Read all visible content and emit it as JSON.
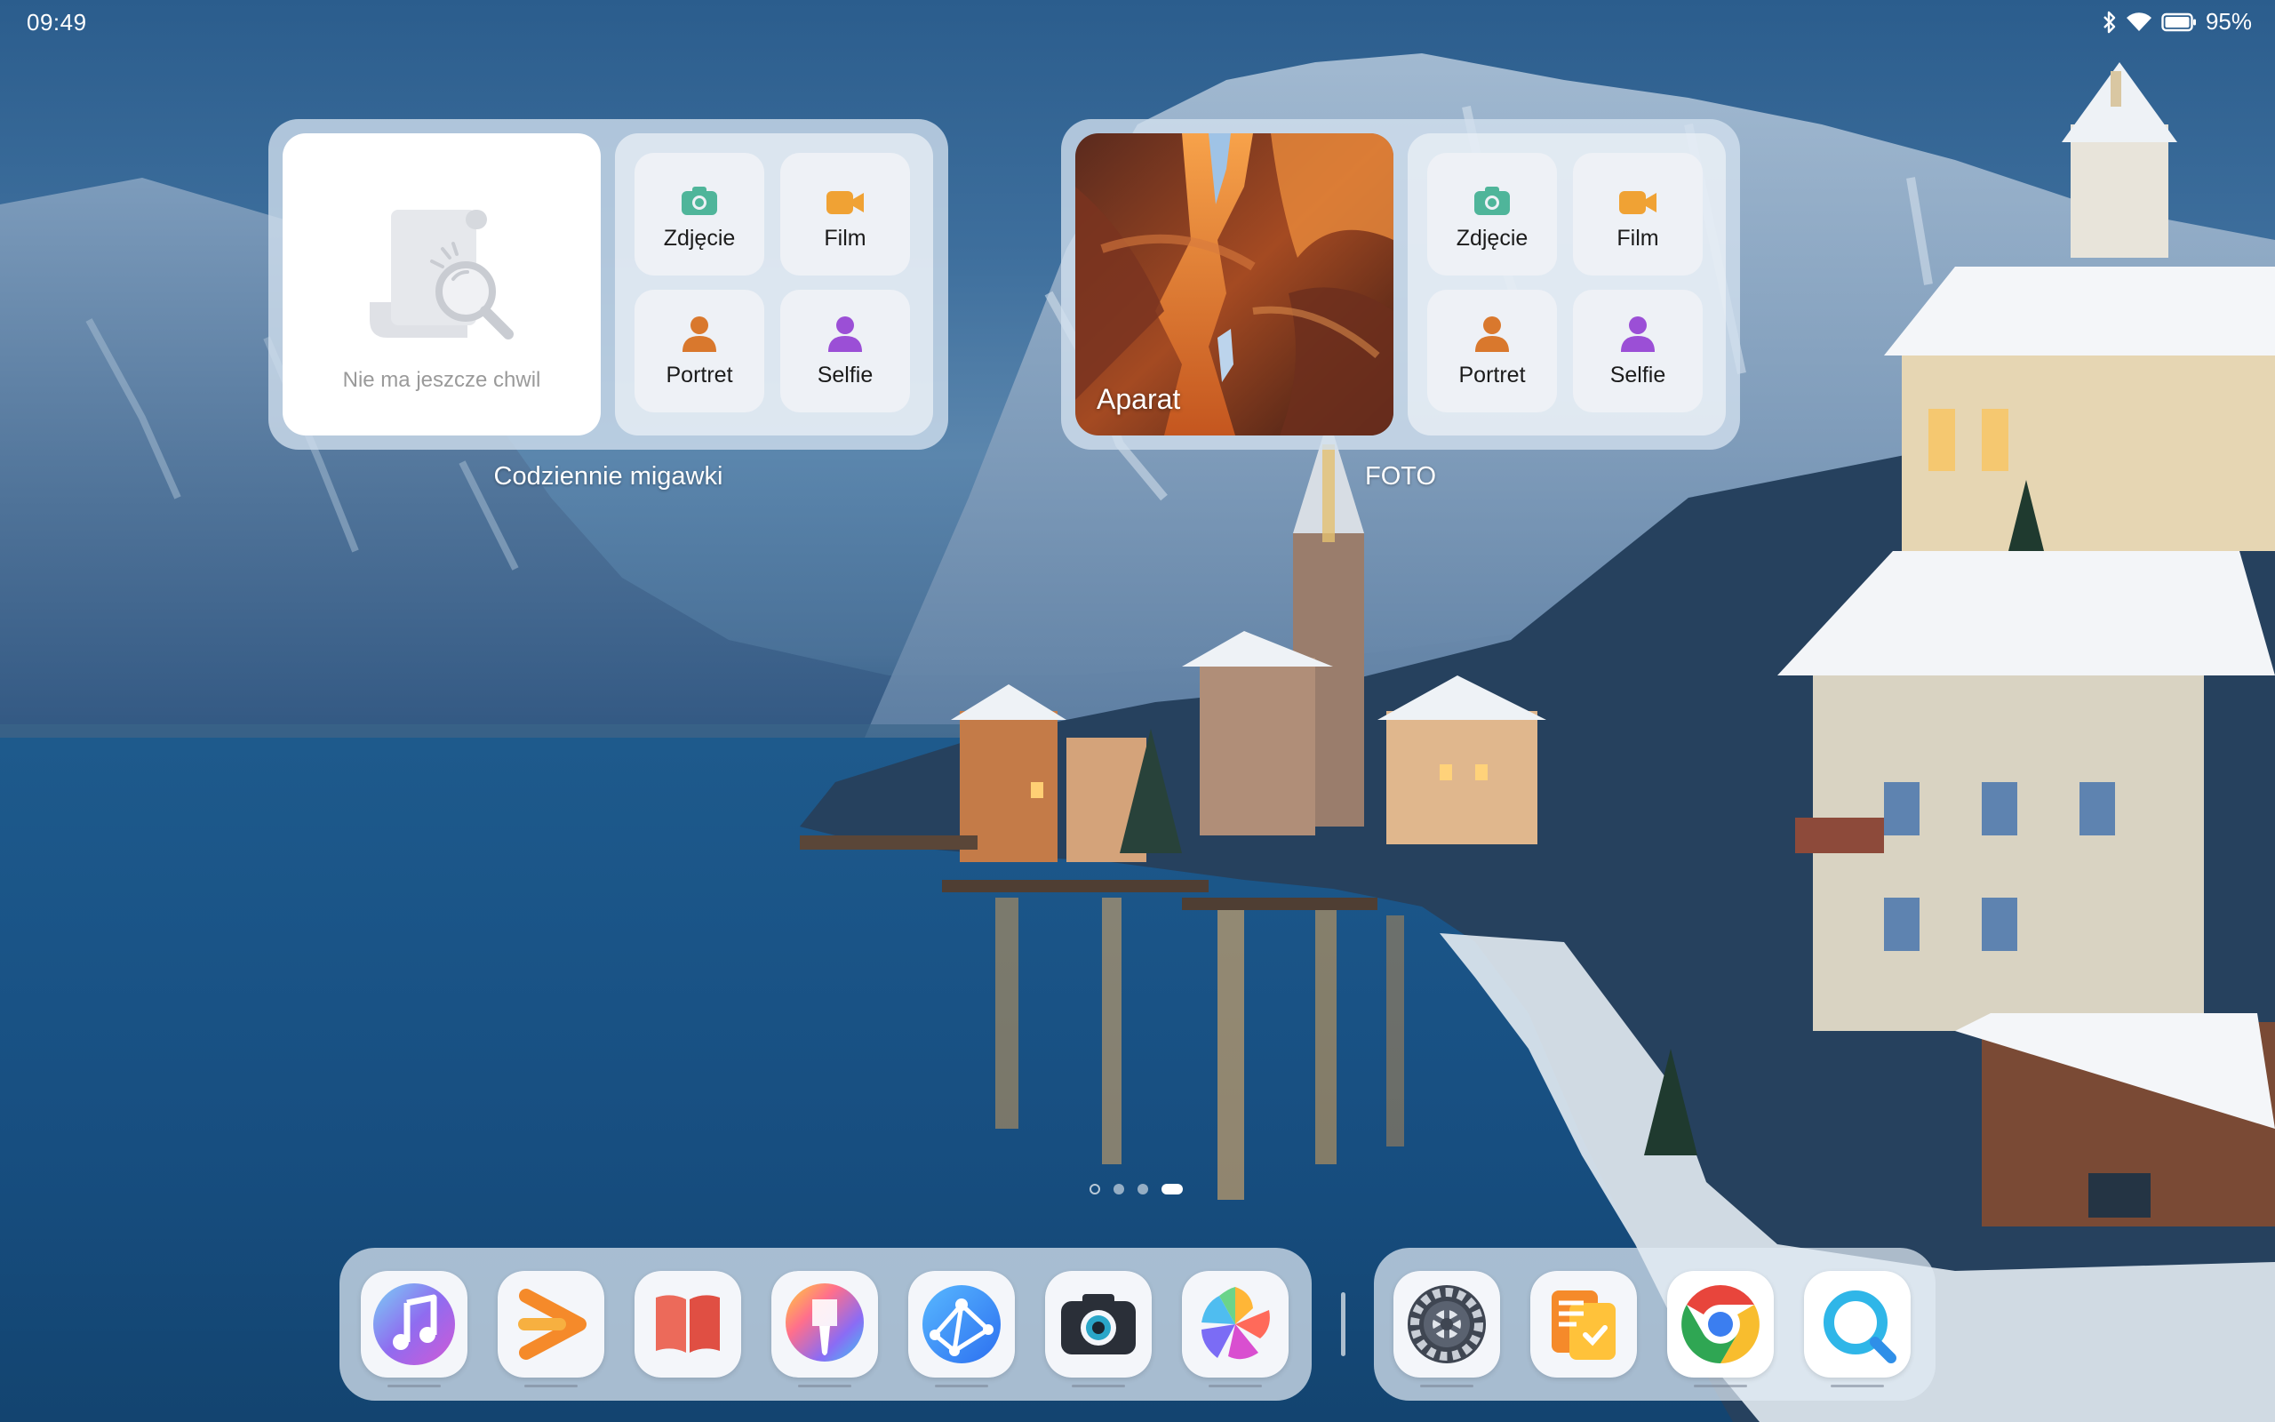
{
  "status_bar": {
    "time": "09:49",
    "battery": "95%",
    "icons": [
      "bluetooth-icon",
      "wifi-icon",
      "battery-icon"
    ]
  },
  "widgets": {
    "memories": {
      "empty_text": "Nie ma jeszcze chwil",
      "caption": "Codziennie migawki",
      "modes": [
        {
          "label": "Zdjęcie",
          "icon": "camera-icon"
        },
        {
          "label": "Film",
          "icon": "video-icon"
        },
        {
          "label": "Portret",
          "icon": "portrait-icon"
        },
        {
          "label": "Selfie",
          "icon": "selfie-icon"
        }
      ]
    },
    "camera": {
      "photo_label": "Aparat",
      "caption": "FOTO",
      "modes": [
        {
          "label": "Zdjęcie",
          "icon": "camera-icon"
        },
        {
          "label": "Film",
          "icon": "video-icon"
        },
        {
          "label": "Portret",
          "icon": "portrait-icon"
        },
        {
          "label": "Selfie",
          "icon": "selfie-icon"
        }
      ]
    }
  },
  "pager": {
    "pages": 4,
    "active_index": 3
  },
  "dock": {
    "left_apps": [
      "music-app-icon",
      "video-player-app-icon",
      "books-app-icon",
      "themes-app-icon",
      "browser-app-icon",
      "camera-app-icon",
      "gallery-app-icon"
    ],
    "right_apps": [
      "settings-app-icon",
      "docs-app-icon",
      "chrome-app-icon",
      "search-app-icon"
    ]
  },
  "colors": {
    "mode_green": "#4fb59a",
    "mode_orange": "#f0a234",
    "mode_portrait": "#d9782d",
    "mode_selfie": "#9b4fd6"
  }
}
